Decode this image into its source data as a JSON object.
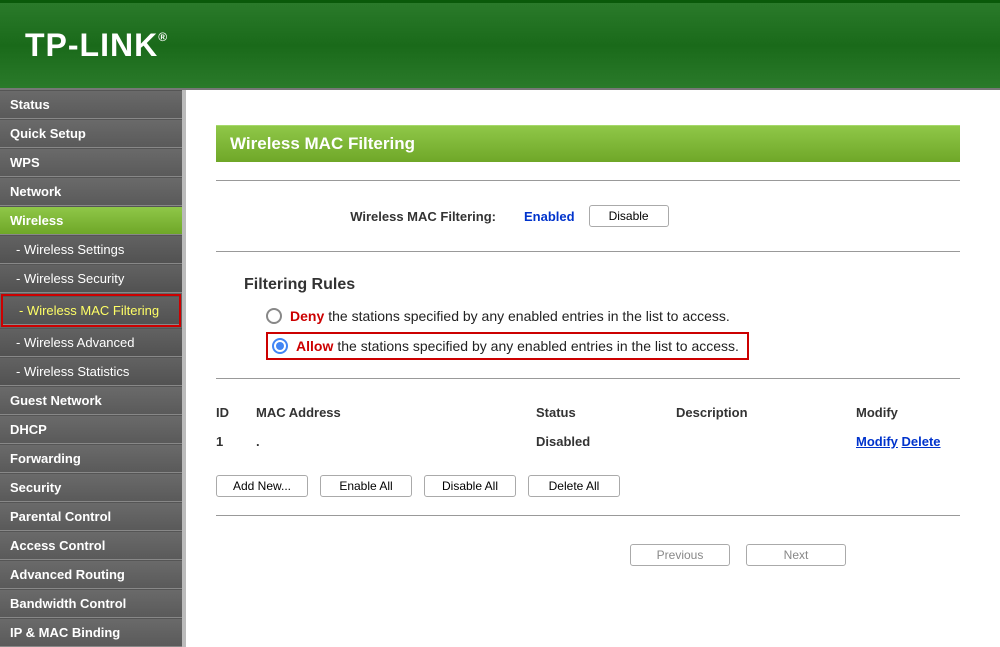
{
  "header": {
    "logo": "TP-LINK"
  },
  "sidebar": {
    "items": [
      {
        "label": "Status",
        "active": false,
        "sub": false
      },
      {
        "label": "Quick Setup",
        "active": false,
        "sub": false
      },
      {
        "label": "WPS",
        "active": false,
        "sub": false
      },
      {
        "label": "Network",
        "active": false,
        "sub": false
      },
      {
        "label": "Wireless",
        "active": true,
        "sub": false
      },
      {
        "label": "- Wireless Settings",
        "active": false,
        "sub": true
      },
      {
        "label": "- Wireless Security",
        "active": false,
        "sub": true
      },
      {
        "label": "- Wireless MAC Filtering",
        "active": false,
        "sub": true,
        "highlighted": true
      },
      {
        "label": "- Wireless Advanced",
        "active": false,
        "sub": true
      },
      {
        "label": "- Wireless Statistics",
        "active": false,
        "sub": true
      },
      {
        "label": "Guest Network",
        "active": false,
        "sub": false
      },
      {
        "label": "DHCP",
        "active": false,
        "sub": false
      },
      {
        "label": "Forwarding",
        "active": false,
        "sub": false
      },
      {
        "label": "Security",
        "active": false,
        "sub": false
      },
      {
        "label": "Parental Control",
        "active": false,
        "sub": false
      },
      {
        "label": "Access Control",
        "active": false,
        "sub": false
      },
      {
        "label": "Advanced Routing",
        "active": false,
        "sub": false
      },
      {
        "label": "Bandwidth Control",
        "active": false,
        "sub": false
      },
      {
        "label": "IP & MAC Binding",
        "active": false,
        "sub": false
      }
    ]
  },
  "main": {
    "title": "Wireless MAC Filtering",
    "status": {
      "label": "Wireless MAC Filtering:",
      "value": "Enabled",
      "button": "Disable"
    },
    "rules": {
      "title": "Filtering Rules",
      "options": [
        {
          "keyword": "Deny",
          "text": "the stations specified by any enabled entries in the list to access.",
          "checked": false
        },
        {
          "keyword": "Allow",
          "text": "the stations specified by any enabled entries in the list to access.",
          "checked": true
        }
      ]
    },
    "table": {
      "headers": {
        "id": "ID",
        "mac": "MAC Address",
        "status": "Status",
        "desc": "Description",
        "modify": "Modify"
      },
      "rows": [
        {
          "id": "1",
          "mac": ".",
          "status": "Disabled",
          "desc": "",
          "modify_label": "Modify",
          "delete_label": "Delete"
        }
      ]
    },
    "actions": {
      "add": "Add New...",
      "enable_all": "Enable All",
      "disable_all": "Disable All",
      "delete_all": "Delete All"
    },
    "pagination": {
      "previous": "Previous",
      "next": "Next"
    }
  }
}
